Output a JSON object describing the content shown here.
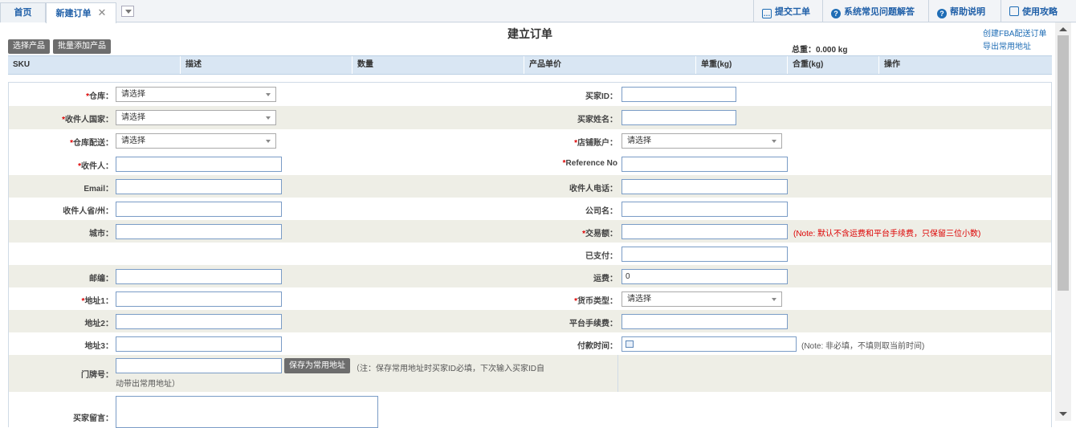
{
  "tabs": [
    {
      "label": "首页"
    },
    {
      "label": "新建订单",
      "close": "✕"
    }
  ],
  "top_links": [
    {
      "label": "提交工单",
      "icon": "chat-icon"
    },
    {
      "label": "系统常见问题解答",
      "icon": "question-icon"
    },
    {
      "label": "帮助说明",
      "icon": "help-icon"
    },
    {
      "label": "使用攻略",
      "icon": "book-icon"
    }
  ],
  "page_title": "建立订单",
  "right_links": [
    "创建FBA配送订单",
    "导出常用地址"
  ],
  "total_weight": "总重：0.000 kg",
  "toolbar": {
    "select_product": "选择产品",
    "batch_add": "批量添加产品"
  },
  "columns": [
    "SKU",
    "描述",
    "数量",
    "产品单价",
    "单重(kg)",
    "合重(kg)",
    "操作"
  ],
  "left_fields": [
    {
      "req": "*",
      "label": "仓库：",
      "type": "select",
      "value": "请选择"
    },
    {
      "req": "*",
      "label": "收件人国家：",
      "type": "select",
      "value": "请选择"
    },
    {
      "req": "*",
      "label": "仓库配送：",
      "type": "select",
      "value": "请选择"
    },
    {
      "req": "*",
      "label": "收件人：",
      "type": "input",
      "value": ""
    },
    {
      "req": "",
      "label": "Email：",
      "type": "input",
      "value": ""
    },
    {
      "req": "",
      "label": "收件人省/州：",
      "type": "input",
      "value": ""
    },
    {
      "req": "",
      "label": "城市：",
      "type": "input",
      "value": ""
    },
    {
      "req": "",
      "label": "",
      "type": "none",
      "value": ""
    },
    {
      "req": "",
      "label": "邮编：",
      "type": "input",
      "value": ""
    },
    {
      "req": "*",
      "label": "地址1：",
      "type": "input",
      "value": ""
    },
    {
      "req": "",
      "label": "地址2：",
      "type": "input",
      "value": ""
    },
    {
      "req": "",
      "label": "地址3：",
      "type": "input",
      "value": ""
    }
  ],
  "right_fields": [
    {
      "req": "",
      "label": "买家ID：",
      "type": "input",
      "value": ""
    },
    {
      "req": "",
      "label": "买家姓名：",
      "type": "input",
      "value": ""
    },
    {
      "req": "*",
      "label": "店铺账户：",
      "type": "select",
      "value": "请选择"
    },
    {
      "req": "*",
      "label": "Reference No",
      "type": "input",
      "value": ""
    },
    {
      "req": "",
      "label": "收件人电话：",
      "type": "input",
      "value": ""
    },
    {
      "req": "",
      "label": "公司名：",
      "type": "input",
      "value": ""
    },
    {
      "req": "*",
      "label": "交易额：",
      "type": "input",
      "value": ""
    },
    {
      "req": "",
      "label": "已支付：",
      "type": "input",
      "value": ""
    },
    {
      "req": "",
      "label": "运费：",
      "type": "input",
      "value": "0"
    },
    {
      "req": "*",
      "label": "货币类型：",
      "type": "select",
      "value": "请选择"
    },
    {
      "req": "",
      "label": "平台手续费：",
      "type": "input",
      "value": ""
    },
    {
      "req": "",
      "label": "付款时间：",
      "type": "date",
      "value": ""
    }
  ],
  "notes": {
    "amount": "(Note: 默认不含运费和平台手续费，只保留三位小数)",
    "paytime": "(Note: 非必填，不填则取当前时间)"
  },
  "door": {
    "label": "门牌号：",
    "save_btn": "保存为常用地址",
    "hint1": "（注：保存常用地址时买家ID必填，下次输入买家ID自",
    "hint2": "动带出常用地址）"
  },
  "buyer_note": {
    "label": "买家留言："
  }
}
